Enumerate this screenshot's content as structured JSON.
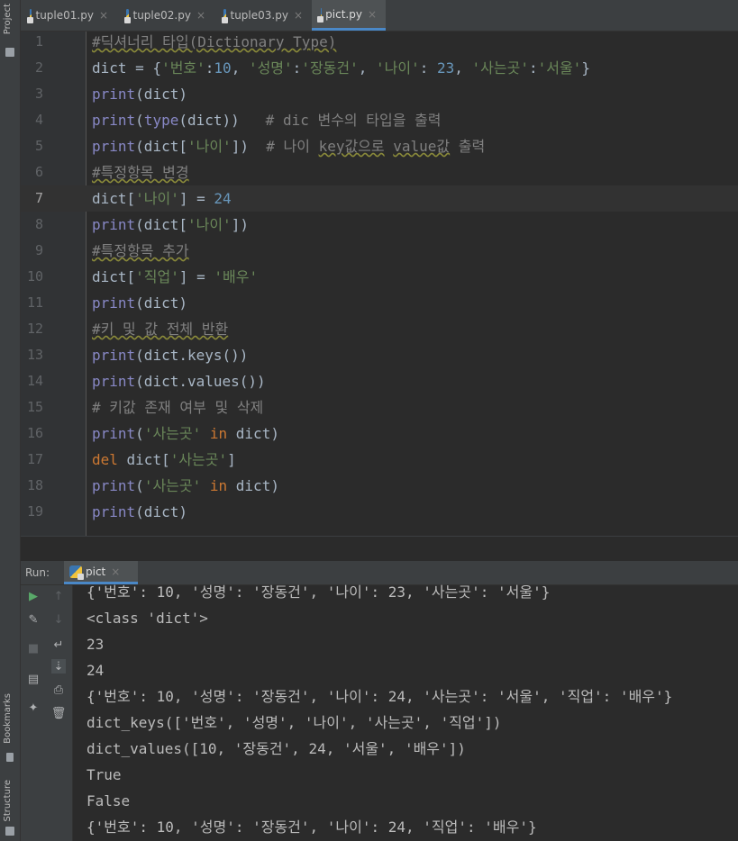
{
  "tool_window_labels": {
    "project": "Project",
    "bookmarks": "Bookmarks",
    "structure": "Structure"
  },
  "tabs": [
    {
      "label": "tuple01.py",
      "active": false
    },
    {
      "label": "tuple02.py",
      "active": false
    },
    {
      "label": "tuple03.py",
      "active": false
    },
    {
      "label": "pict.py",
      "active": true
    }
  ],
  "tab_close_glyph": "×",
  "editor": {
    "current_line": 7,
    "line_numbers": [
      "1",
      "2",
      "3",
      "4",
      "5",
      "6",
      "7",
      "8",
      "9",
      "10",
      "11",
      "12",
      "13",
      "14",
      "15",
      "16",
      "17",
      "18",
      "19"
    ]
  },
  "run_panel": {
    "label": "Run:",
    "tab": "pict"
  },
  "output_lines": [
    "{'번호': 10, '성명': '장동건', '나이': 23, '사는곳': '서울'}",
    "<class 'dict'>",
    "23",
    "24",
    "{'번호': 10, '성명': '장동건', '나이': 24, '사는곳': '서울', '직업': '배우'}",
    "dict_keys(['번호', '성명', '나이', '사는곳', '직업'])",
    "dict_values([10, '장동건', 24, '서울', '배우'])",
    "True",
    "False",
    "{'번호': 10, '성명': '장동건', '나이': 24, '직업': '배우'}"
  ],
  "colors": {
    "keyword": "#cc7832",
    "builtin": "#8888c6",
    "string": "#6a8759",
    "number": "#6897bb",
    "comment": "#808080",
    "accent": "#4a88c7"
  }
}
